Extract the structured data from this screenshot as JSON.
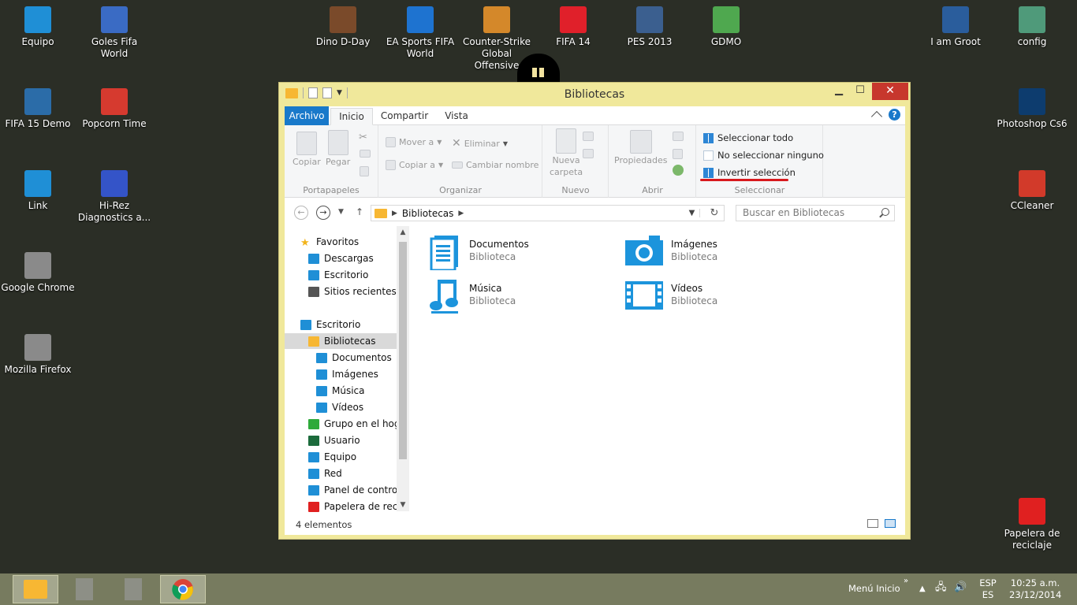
{
  "desktop": {
    "icons": [
      {
        "label": "Equipo",
        "icon": "computer-icon",
        "color": "#1f8fd6"
      },
      {
        "label": "Goles Fifa World",
        "icon": "app-icon",
        "color": "#3a6bc4"
      },
      {
        "label": "Dino D-Day",
        "icon": "dinosaur-icon",
        "color": "#7a4a2a"
      },
      {
        "label": "EA Sports FIFA World",
        "icon": "ea-fifa-icon",
        "color": "#1e73d0"
      },
      {
        "label": "Counter-Strike Global Offensive",
        "icon": "csgo-icon",
        "color": "#d4882a"
      },
      {
        "label": "FIFA 14",
        "icon": "fifa14-icon",
        "color": "#e0202a"
      },
      {
        "label": "PES 2013",
        "icon": "pes-icon",
        "color": "#3b5f8f"
      },
      {
        "label": "GDMO",
        "icon": "gdmo-icon",
        "color": "#4fa84f"
      },
      {
        "label": "I am Groot",
        "icon": "shortcut-icon",
        "color": "#2a5d9c"
      },
      {
        "label": "config",
        "icon": "config-file-icon",
        "color": "#4f9a7a"
      },
      {
        "label": "FIFA 15 Demo",
        "icon": "fifa15-icon",
        "color": "#2b6ca8"
      },
      {
        "label": "Popcorn Time",
        "icon": "popcorn-icon",
        "color": "#d63a2f"
      },
      {
        "label": "Link",
        "icon": "document-icon",
        "color": "#1f8fd6"
      },
      {
        "label": "Hi-Rez Diagnostics a...",
        "icon": "hirez-icon",
        "color": "#3454c8"
      },
      {
        "label": "Google Chrome",
        "icon": "shortcut-file-icon",
        "color": "#8a8a8a"
      },
      {
        "label": "Mozilla Firefox",
        "icon": "shortcut-file-icon",
        "color": "#8a8a8a"
      },
      {
        "label": "Photoshop Cs6",
        "icon": "photoshop-icon",
        "color": "#0d3c6e"
      },
      {
        "label": "CCleaner",
        "icon": "ccleaner-icon",
        "color": "#d23a2a"
      },
      {
        "label": "Papelera de reciclaje",
        "icon": "recycle-bin-icon",
        "color": "#e02020"
      }
    ]
  },
  "window": {
    "title": "Bibliotecas",
    "tabs": {
      "archivo": "Archivo",
      "inicio": "Inicio",
      "compartir": "Compartir",
      "vista": "Vista"
    },
    "ribbon": {
      "portapapeles": {
        "copiar": "Copiar",
        "pegar": "Pegar",
        "label": "Portapapeles"
      },
      "organizar": {
        "mover": "Mover a",
        "copiar_a": "Copiar a",
        "eliminar": "Eliminar",
        "cambiar": "Cambiar nombre",
        "label": "Organizar"
      },
      "nuevo": {
        "nueva_carpeta_1": "Nueva",
        "nueva_carpeta_2": "carpeta",
        "label": "Nuevo"
      },
      "abrir": {
        "propiedades": "Propiedades",
        "label": "Abrir"
      },
      "seleccionar": {
        "todo": "Seleccionar todo",
        "ninguno": "No seleccionar ninguno",
        "invertir": "Invertir selección",
        "label": "Seleccionar"
      }
    },
    "address": {
      "path": "Bibliotecas",
      "search_placeholder": "Buscar en Bibliotecas"
    },
    "nav": [
      {
        "label": "Favoritos",
        "icon": "star-icon",
        "color": "#f2b41b"
      },
      {
        "label": "Descargas",
        "icon": "downloads-icon",
        "color": "#1f8fd6"
      },
      {
        "label": "Escritorio",
        "icon": "desktop-icon",
        "color": "#1f8fd6"
      },
      {
        "label": "Sitios recientes",
        "icon": "recent-places-icon",
        "color": "#555555"
      },
      {
        "label": "Escritorio",
        "icon": "desktop-icon",
        "color": "#1f8fd6"
      },
      {
        "label": "Bibliotecas",
        "icon": "libraries-folder-icon",
        "color": "#f7b733"
      },
      {
        "label": "Documentos",
        "icon": "documents-icon",
        "color": "#1f8fd6"
      },
      {
        "label": "Imágenes",
        "icon": "pictures-icon",
        "color": "#1f8fd6"
      },
      {
        "label": "Música",
        "icon": "music-icon",
        "color": "#1f8fd6"
      },
      {
        "label": "Vídeos",
        "icon": "videos-icon",
        "color": "#1f8fd6"
      },
      {
        "label": "Grupo en el hogar",
        "icon": "homegroup-icon",
        "color": "#2eaa3a"
      },
      {
        "label": "Usuario",
        "icon": "user-icon",
        "color": "#1c6b3c"
      },
      {
        "label": "Equipo",
        "icon": "computer-icon",
        "color": "#1f8fd6"
      },
      {
        "label": "Red",
        "icon": "network-icon",
        "color": "#1f8fd6"
      },
      {
        "label": "Panel de control",
        "icon": "control-panel-icon",
        "color": "#1f8fd6"
      },
      {
        "label": "Papelera de reciclaje",
        "icon": "recycle-bin-icon",
        "color": "#e02020"
      }
    ],
    "libraries": [
      {
        "name": "Documentos",
        "type": "Biblioteca",
        "icon": "documents-library-icon"
      },
      {
        "name": "Imágenes",
        "type": "Biblioteca",
        "icon": "pictures-library-icon"
      },
      {
        "name": "Música",
        "type": "Biblioteca",
        "icon": "music-library-icon"
      },
      {
        "name": "Vídeos",
        "type": "Biblioteca",
        "icon": "videos-library-icon"
      }
    ],
    "status": "4 elementos"
  },
  "taskbar": {
    "menu_inicio": "Menú Inicio",
    "lang_1": "ESP",
    "lang_2": "ES",
    "time": "10:25 a.m.",
    "date": "23/12/2014"
  },
  "colors": {
    "accent": "#1979ca",
    "library_blue": "#1c94dc",
    "window_frame": "#f0e89b",
    "taskbar": "#777b5f",
    "highlight_underline": "#d8191d"
  }
}
